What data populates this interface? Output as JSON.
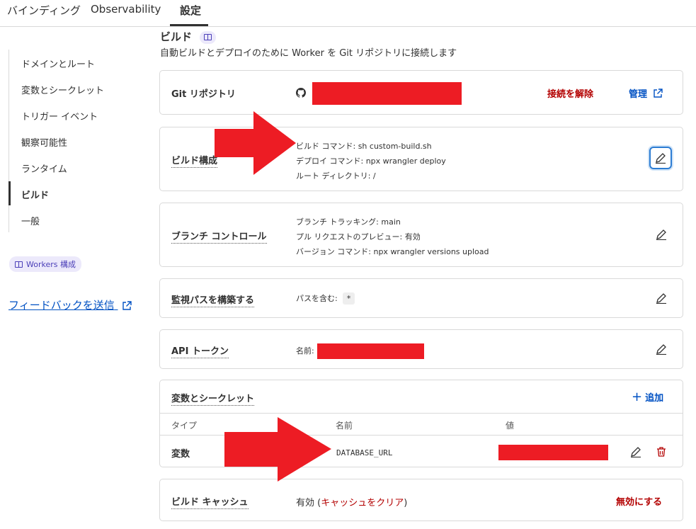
{
  "tabs": [
    {
      "label": "バインディング"
    },
    {
      "label": "Observability"
    },
    {
      "label": "設定",
      "active": true
    }
  ],
  "sidebar": {
    "items": [
      {
        "label": "ドメインとルート"
      },
      {
        "label": "変数とシークレット"
      },
      {
        "label": "トリガー イベント"
      },
      {
        "label": "観察可能性"
      },
      {
        "label": "ランタイム"
      },
      {
        "label": "ビルド",
        "active": true
      },
      {
        "label": "一般"
      }
    ],
    "workers_pill": "Workers 構成",
    "feedback": "フィードバックを送信"
  },
  "section": {
    "title": "ビルド",
    "subtitle": "自動ビルドとデプロイのために Worker を Git リポジトリに接続します"
  },
  "git": {
    "label": "Git リポジトリ",
    "disconnect": "接続を解除",
    "manage": "管理"
  },
  "build_config": {
    "label": "ビルド構成",
    "lines": [
      "ビルド コマンド: sh custom-build.sh",
      "デプロイ コマンド: npx wrangler deploy",
      "ルート ディレクトリ: /"
    ]
  },
  "branch_control": {
    "label": "ブランチ コントロール",
    "lines": [
      "ブランチ トラッキング: main",
      "プル リクエストのプレビュー: 有効",
      "バージョン コマンド: npx wrangler versions upload"
    ]
  },
  "watch_paths": {
    "label": "監視パスを構築する",
    "include_label": "パスを含む:",
    "include_value": "*"
  },
  "api_token": {
    "label": "API トークン",
    "name_label": "名前:"
  },
  "variables": {
    "label": "変数とシークレット",
    "add": "追加",
    "headers": [
      "タイプ",
      "名前",
      "値"
    ],
    "rows": [
      {
        "type": "変数",
        "name": "DATABASE_URL"
      }
    ]
  },
  "build_cache": {
    "label": "ビルド キャッシュ",
    "status": "有効",
    "clear": "キャッシュをクリア",
    "disable": "無効にする"
  },
  "colors": {
    "accent_blue": "#0051c3",
    "danger_red": "#b30000",
    "annotation_red": "#ed1c24"
  }
}
